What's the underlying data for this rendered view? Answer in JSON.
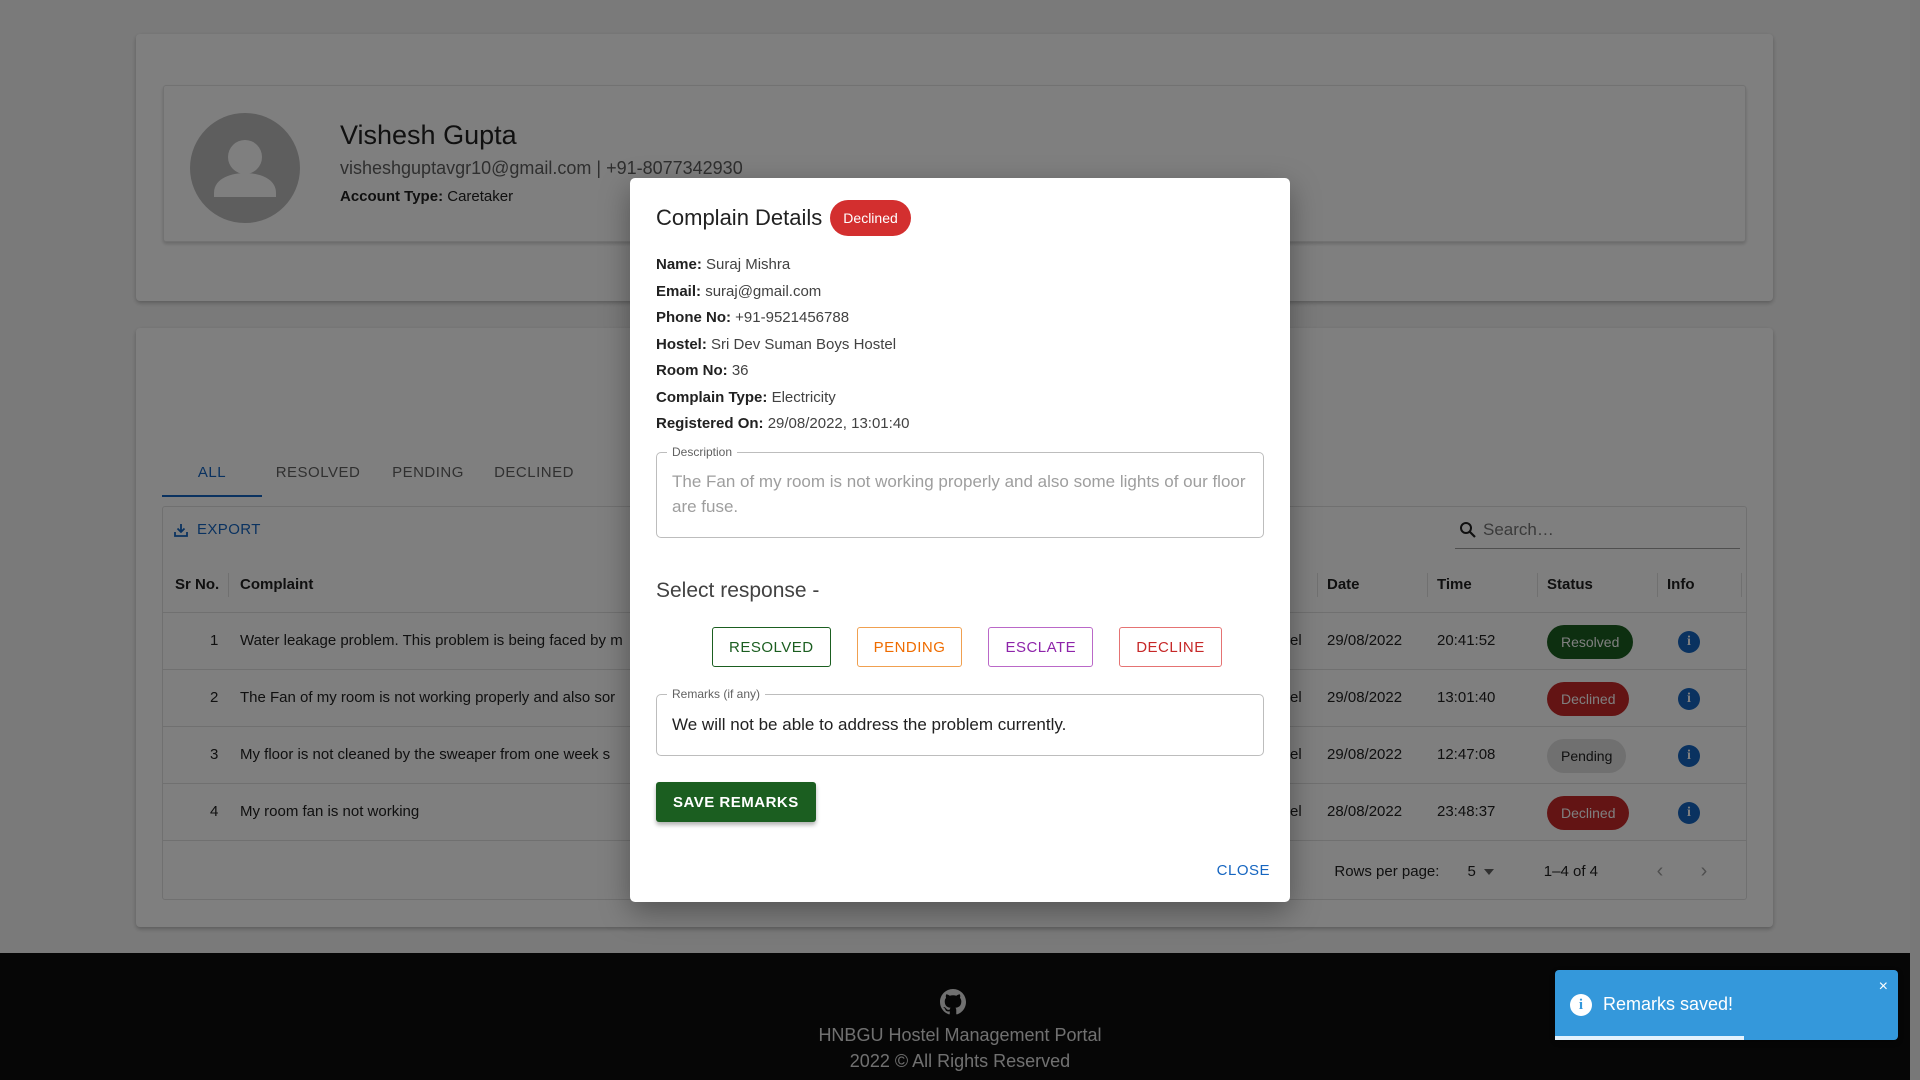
{
  "profile": {
    "name": "Vishesh Gupta",
    "contact": "visheshguptavgr10@gmail.com | +91-8077342930",
    "account_type_label": "Account Type:",
    "account_type_value": "Caretaker"
  },
  "tabs": [
    "ALL",
    "RESOLVED",
    "PENDING",
    "DECLINED"
  ],
  "toolbar": {
    "export_label": "EXPORT",
    "search_placeholder": "Search…"
  },
  "table": {
    "headers": {
      "sr": "Sr No.",
      "complaint": "Complaint",
      "date": "Date",
      "time": "Time",
      "status": "Status",
      "info": "Info"
    },
    "rows": [
      {
        "sr": "1",
        "complaint": "Water leakage problem. This problem is being faced by m",
        "hostel_tail": "el",
        "date": "29/08/2022",
        "time": "20:41:52",
        "status": "Resolved"
      },
      {
        "sr": "2",
        "complaint": "The Fan of my room is not working properly and also sor",
        "hostel_tail": "el",
        "date": "29/08/2022",
        "time": "13:01:40",
        "status": "Declined"
      },
      {
        "sr": "3",
        "complaint": "My floor is not cleaned by the sweaper from one week s",
        "hostel_tail": "el",
        "date": "29/08/2022",
        "time": "12:47:08",
        "status": "Pending"
      },
      {
        "sr": "4",
        "complaint": "My room fan is not working",
        "hostel_tail": "el",
        "date": "28/08/2022",
        "time": "23:48:37",
        "status": "Declined"
      }
    ],
    "pagination": {
      "rows_per_page_label": "Rows per page:",
      "rows_per_page": "5",
      "range": "1–4 of 4"
    }
  },
  "footer": {
    "title": "HNBGU Hostel Management Portal",
    "copyright": "2022 © All Rights Reserved"
  },
  "dialog": {
    "title": "Complain Details",
    "status_badge": "Declined",
    "fields": [
      {
        "label": "Name:",
        "value": "Suraj Mishra"
      },
      {
        "label": "Email:",
        "value": "suraj@gmail.com"
      },
      {
        "label": "Phone No:",
        "value": "+91-9521456788"
      },
      {
        "label": "Hostel:",
        "value": "Sri Dev Suman Boys Hostel"
      },
      {
        "label": "Room No:",
        "value": "36"
      },
      {
        "label": "Complain Type:",
        "value": "Electricity"
      },
      {
        "label": "Registered On:",
        "value": "29/08/2022, 13:01:40"
      }
    ],
    "description_label": "Description",
    "description": "The Fan of my room is not working properly and also some lights of our floor are fuse.",
    "select_response_heading": "Select response -",
    "response_buttons": {
      "resolved": "RESOLVED",
      "pending": "PENDING",
      "esclate": "ESCLATE",
      "decline": "DECLINE"
    },
    "remarks_label": "Remarks (if any)",
    "remarks": "We will not be able to address the problem currently.",
    "save_label": "SAVE REMARKS",
    "close_label": "CLOSE"
  },
  "toast": {
    "message": "Remarks saved!",
    "close_icon": "×",
    "progress_fraction": 0.55
  },
  "colors": {
    "primary": "#1565c0",
    "resolved": "#1b5e20",
    "declined": "#c62828",
    "pending_chip": "#e0e0e0",
    "toast": "#3498db",
    "footer": "#0d0d0d"
  },
  "icons": [
    "avatar-person-icon",
    "download-icon",
    "search-icon",
    "info-icon",
    "chevron-left-icon",
    "chevron-right-icon",
    "caret-down-icon",
    "github-icon",
    "toast-info-icon",
    "close-icon"
  ]
}
